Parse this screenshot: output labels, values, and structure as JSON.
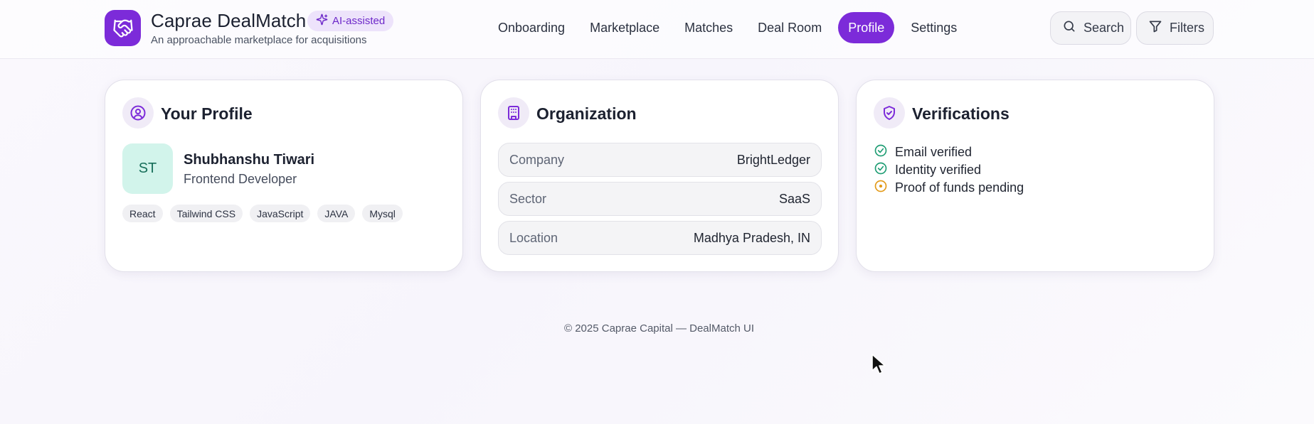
{
  "brand": {
    "title": "Caprae DealMatch",
    "badge": "AI-assisted",
    "subtitle": "An approachable marketplace for acquisitions",
    "accent_color": "#7c2bd9"
  },
  "nav": {
    "items": [
      {
        "label": "Onboarding",
        "active": false
      },
      {
        "label": "Marketplace",
        "active": false
      },
      {
        "label": "Matches",
        "active": false
      },
      {
        "label": "Deal Room",
        "active": false
      },
      {
        "label": "Profile",
        "active": true
      },
      {
        "label": "Settings",
        "active": false
      }
    ]
  },
  "header_actions": {
    "search_label": "Search",
    "filters_label": "Filters"
  },
  "profile": {
    "title": "Your Profile",
    "initials": "ST",
    "name": "Shubhanshu Tiwari",
    "role": "Frontend Developer",
    "skills": [
      "React",
      "Tailwind CSS",
      "JavaScript",
      "JAVA",
      "Mysql"
    ]
  },
  "organization": {
    "title": "Organization",
    "fields": [
      {
        "key": "Company",
        "value": "BrightLedger"
      },
      {
        "key": "Sector",
        "value": "SaaS"
      },
      {
        "key": "Location",
        "value": "Madhya Pradesh, IN"
      }
    ]
  },
  "verifications": {
    "title": "Verifications",
    "items": [
      {
        "label": "Email verified",
        "status": "verified",
        "icon": "check-circle-icon",
        "color": "#1f9d74"
      },
      {
        "label": "Identity verified",
        "status": "verified",
        "icon": "check-circle-icon",
        "color": "#1f9d74"
      },
      {
        "label": "Proof of funds pending",
        "status": "pending",
        "icon": "pending-circle-icon",
        "color": "#e39a18"
      }
    ]
  },
  "footer": {
    "text": "© 2025 Caprae Capital — DealMatch UI"
  }
}
